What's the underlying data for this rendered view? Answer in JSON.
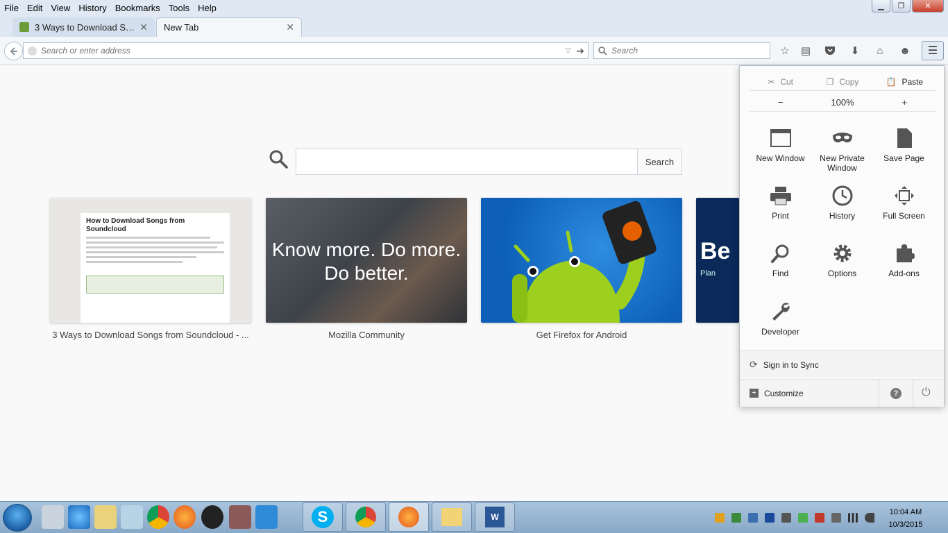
{
  "menubar": {
    "items": [
      "File",
      "Edit",
      "View",
      "History",
      "Bookmarks",
      "Tools",
      "Help"
    ]
  },
  "tabs": [
    {
      "label": "3 Ways to Download Songs...",
      "active": false
    },
    {
      "label": "New Tab",
      "active": true
    }
  ],
  "navbar": {
    "url_placeholder": "Search or enter address",
    "search_placeholder": "Search"
  },
  "newtab": {
    "search_button": "Search",
    "tiles": [
      {
        "title": "3 Ways to Download Songs from Soundcloud - ...",
        "preview_heading": "How to Download Songs from Soundcloud"
      },
      {
        "title": "Mozilla Community",
        "overlay_line1": "Know more. Do more.",
        "overlay_line2": "Do better."
      },
      {
        "title": "Get Firefox for Android"
      },
      {
        "title": "",
        "overlay": "Be",
        "sub": "Plan"
      }
    ]
  },
  "menu_panel": {
    "edit": {
      "cut": "Cut",
      "copy": "Copy",
      "paste": "Paste"
    },
    "zoom": {
      "minus": "−",
      "level": "100%",
      "plus": "+"
    },
    "items": [
      {
        "label": "New Window",
        "icon": "window-icon"
      },
      {
        "label": "New Private Window",
        "icon": "mask-icon"
      },
      {
        "label": "Save Page",
        "icon": "page-icon"
      },
      {
        "label": "Print",
        "icon": "printer-icon"
      },
      {
        "label": "History",
        "icon": "clock-icon"
      },
      {
        "label": "Full Screen",
        "icon": "fullscreen-icon"
      },
      {
        "label": "Find",
        "icon": "magnifier-icon"
      },
      {
        "label": "Options",
        "icon": "gear-icon"
      },
      {
        "label": "Add-ons",
        "icon": "puzzle-icon"
      },
      {
        "label": "Developer",
        "icon": "wrench-icon"
      }
    ],
    "sync": "Sign in to Sync",
    "customize": "Customize"
  },
  "taskbar": {
    "time": "10:04 AM",
    "date": "10/3/2015"
  }
}
